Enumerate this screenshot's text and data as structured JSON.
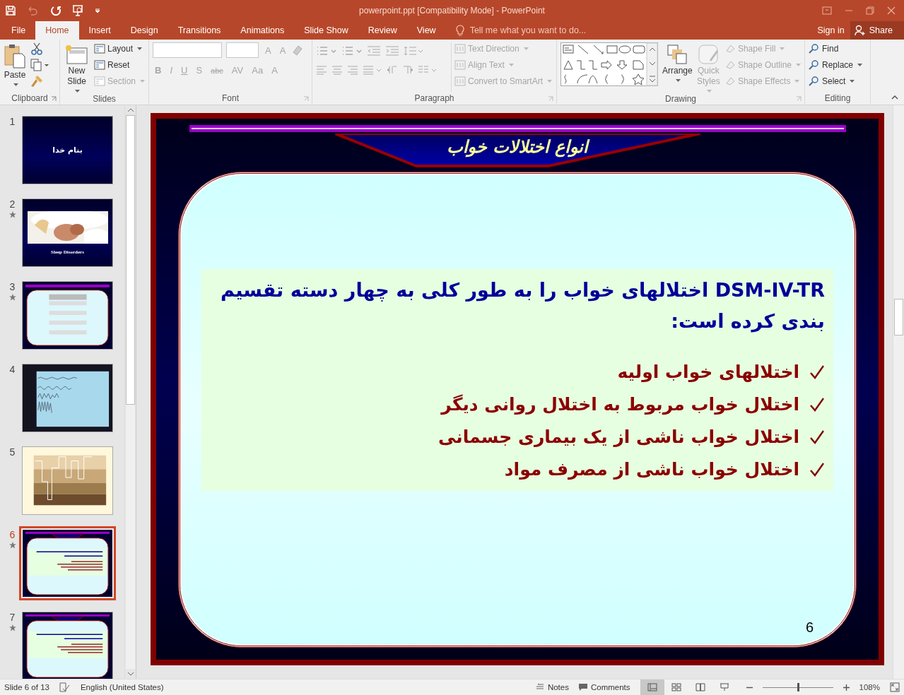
{
  "window": {
    "title": "powerpoint.ppt [Compatibility Mode] - PowerPoint"
  },
  "tabs": [
    {
      "label": "File",
      "selected": false
    },
    {
      "label": "Home",
      "selected": true
    },
    {
      "label": "Insert",
      "selected": false
    },
    {
      "label": "Design",
      "selected": false
    },
    {
      "label": "Transitions",
      "selected": false
    },
    {
      "label": "Animations",
      "selected": false
    },
    {
      "label": "Slide Show",
      "selected": false
    },
    {
      "label": "Review",
      "selected": false
    },
    {
      "label": "View",
      "selected": false
    }
  ],
  "tell_me": {
    "placeholder": "Tell me what you want to do..."
  },
  "account": {
    "sign_in": "Sign in",
    "share": "Share"
  },
  "clipboard": {
    "label": "Clipboard",
    "paste": "Paste"
  },
  "slides_group": {
    "label": "Slides",
    "new_slide": "New Slide",
    "commands": [
      {
        "label": "Layout",
        "disabled": false
      },
      {
        "label": "Reset",
        "disabled": false
      },
      {
        "label": "Section",
        "disabled": true
      }
    ]
  },
  "font": {
    "label": "Font",
    "disabled": true,
    "size_buttons": [
      "A",
      "A"
    ],
    "styles": [
      "B",
      "I",
      "U",
      "S",
      "abc",
      "AV",
      "Aa",
      "A"
    ]
  },
  "paragraph": {
    "label": "Paragraph",
    "commands": [
      {
        "label": "Text Direction",
        "disabled": true
      },
      {
        "label": "Align Text",
        "disabled": true
      },
      {
        "label": "Convert to SmartArt",
        "disabled": true
      }
    ]
  },
  "drawing": {
    "label": "Drawing",
    "arrange": "Arrange",
    "quick_styles": {
      "label": "Quick Styles",
      "disabled": true
    },
    "commands": [
      {
        "label": "Shape Fill",
        "disabled": true
      },
      {
        "label": "Shape Outline",
        "disabled": true
      },
      {
        "label": "Shape Effects",
        "disabled": true
      }
    ]
  },
  "editing": {
    "label": "Editing",
    "commands": [
      {
        "label": "Find",
        "disabled": false
      },
      {
        "label": "Replace",
        "disabled": false
      },
      {
        "label": "Select",
        "disabled": false
      }
    ]
  },
  "thumbnails": [
    {
      "number": "1",
      "kind": "title",
      "text": "بنام خدا",
      "animated": false,
      "selected": false
    },
    {
      "number": "2",
      "text": "Sleep Disorders",
      "animated": true,
      "selected": false
    },
    {
      "number": "3",
      "kind": "table",
      "animated": true,
      "selected": false
    },
    {
      "number": "4",
      "kind": "waves",
      "animated": false,
      "selected": false
    },
    {
      "number": "5",
      "kind": "cycle",
      "animated": false,
      "selected": false
    },
    {
      "number": "6",
      "kind": "text",
      "animated": true,
      "selected": true
    },
    {
      "number": "7",
      "kind": "text",
      "animated": true,
      "selected": false
    }
  ],
  "slide": {
    "title": "انواع اختلالات خواب",
    "intro": "DSM-IV-TR اختلالهای خواب را به طور کلی به چهار دسته تقسیم بندی کرده است:",
    "bullets": [
      "اختلالهای خواب اولیه",
      "اختلال خواب مربوط به اختلال روانی دیگر",
      "اختلال خواب ناشی از یک بیماری جسمانی",
      "اختلال خواب ناشی از مصرف مواد"
    ],
    "page_number": "6"
  },
  "status_bar": {
    "slide_info": "Slide 6 of 13",
    "language": "English (United States)",
    "notes": "Notes",
    "comments": "Comments",
    "views": [
      {
        "kind": "normal",
        "selected": true
      },
      {
        "kind": "sorter",
        "selected": false
      },
      {
        "kind": "reading",
        "selected": false
      },
      {
        "kind": "slideshow",
        "selected": false
      }
    ],
    "zoom": {
      "level": 0.5
    },
    "zoom_text": "108%"
  }
}
